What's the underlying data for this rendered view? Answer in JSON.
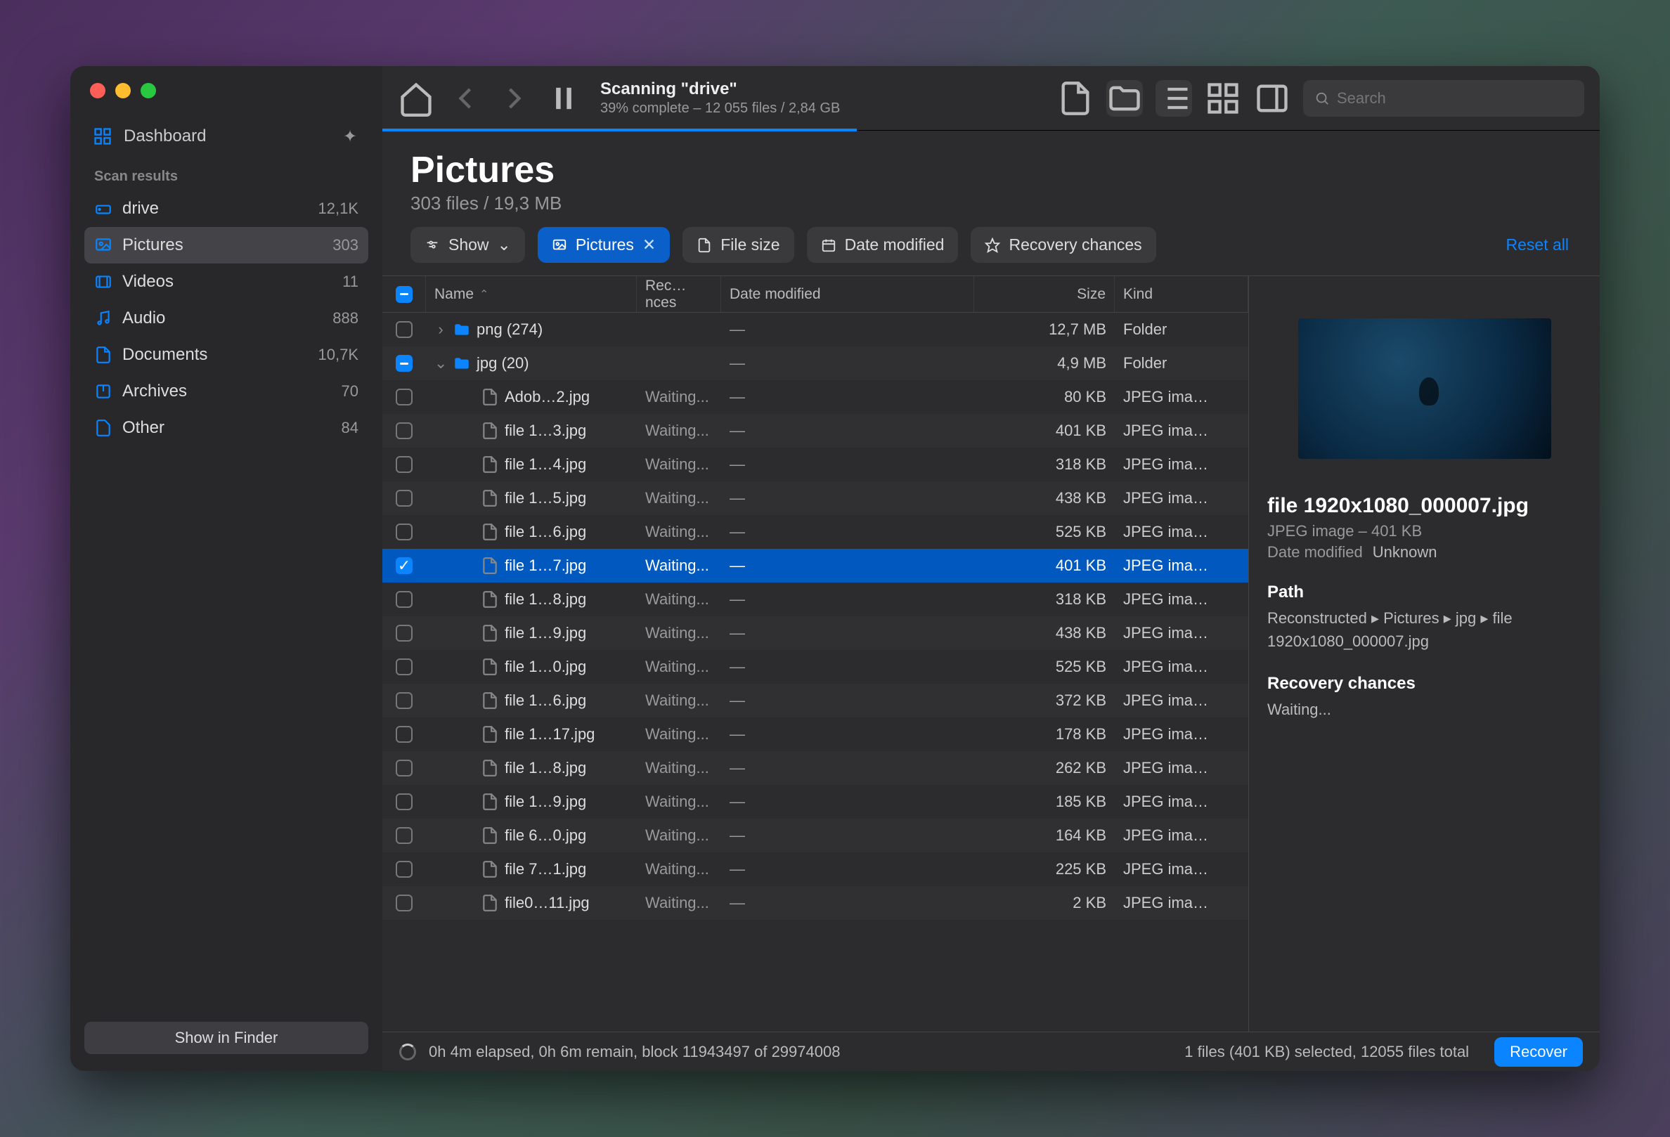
{
  "sidebar": {
    "dashboard": "Dashboard",
    "section_label": "Scan results",
    "items": [
      {
        "icon": "drive-icon",
        "label": "drive",
        "count": "12,1K"
      },
      {
        "icon": "image-icon",
        "label": "Pictures",
        "count": "303",
        "active": true
      },
      {
        "icon": "video-icon",
        "label": "Videos",
        "count": "11"
      },
      {
        "icon": "audio-icon",
        "label": "Audio",
        "count": "888"
      },
      {
        "icon": "doc-icon",
        "label": "Documents",
        "count": "10,7K"
      },
      {
        "icon": "archive-icon",
        "label": "Archives",
        "count": "70"
      },
      {
        "icon": "other-icon",
        "label": "Other",
        "count": "84"
      }
    ],
    "show_in_finder": "Show in Finder"
  },
  "toolbar": {
    "scan_title": "Scanning \"drive\"",
    "scan_sub": "39% complete – 12 055 files / 2,84 GB",
    "search_placeholder": "Search"
  },
  "header": {
    "title": "Pictures",
    "sub": "303 files / 19,3 MB"
  },
  "filters": {
    "show": "Show",
    "pictures": "Pictures",
    "file_size": "File size",
    "date_modified": "Date modified",
    "recovery_chances": "Recovery chances",
    "reset_all": "Reset all"
  },
  "columns": {
    "name": "Name",
    "rec": "Rec…nces",
    "date": "Date modified",
    "size": "Size",
    "kind": "Kind"
  },
  "rows": [
    {
      "type": "folder",
      "disclosure": "right",
      "name": "png (274)",
      "rec": "",
      "date": "—",
      "size": "12,7 MB",
      "kind": "Folder",
      "cb": "empty"
    },
    {
      "type": "folder",
      "disclosure": "down",
      "name": "jpg (20)",
      "rec": "",
      "date": "—",
      "size": "4,9 MB",
      "kind": "Folder",
      "cb": "dash"
    },
    {
      "type": "file",
      "name": "Adob…2.jpg",
      "rec": "Waiting...",
      "date": "—",
      "size": "80 KB",
      "kind": "JPEG ima…",
      "cb": "empty"
    },
    {
      "type": "file",
      "name": "file 1…3.jpg",
      "rec": "Waiting...",
      "date": "—",
      "size": "401 KB",
      "kind": "JPEG ima…",
      "cb": "empty"
    },
    {
      "type": "file",
      "name": "file 1…4.jpg",
      "rec": "Waiting...",
      "date": "—",
      "size": "318 KB",
      "kind": "JPEG ima…",
      "cb": "empty"
    },
    {
      "type": "file",
      "name": "file 1…5.jpg",
      "rec": "Waiting...",
      "date": "—",
      "size": "438 KB",
      "kind": "JPEG ima…",
      "cb": "empty"
    },
    {
      "type": "file",
      "name": "file 1…6.jpg",
      "rec": "Waiting...",
      "date": "—",
      "size": "525 KB",
      "kind": "JPEG ima…",
      "cb": "empty"
    },
    {
      "type": "file",
      "name": "file 1…7.jpg",
      "rec": "Waiting...",
      "date": "—",
      "size": "401 KB",
      "kind": "JPEG ima…",
      "cb": "checked",
      "selected": true
    },
    {
      "type": "file",
      "name": "file 1…8.jpg",
      "rec": "Waiting...",
      "date": "—",
      "size": "318 KB",
      "kind": "JPEG ima…",
      "cb": "empty"
    },
    {
      "type": "file",
      "name": "file 1…9.jpg",
      "rec": "Waiting...",
      "date": "—",
      "size": "438 KB",
      "kind": "JPEG ima…",
      "cb": "empty"
    },
    {
      "type": "file",
      "name": "file 1…0.jpg",
      "rec": "Waiting...",
      "date": "—",
      "size": "525 KB",
      "kind": "JPEG ima…",
      "cb": "empty"
    },
    {
      "type": "file",
      "name": "file 1…6.jpg",
      "rec": "Waiting...",
      "date": "—",
      "size": "372 KB",
      "kind": "JPEG ima…",
      "cb": "empty"
    },
    {
      "type": "file",
      "name": "file 1…17.jpg",
      "rec": "Waiting...",
      "date": "—",
      "size": "178 KB",
      "kind": "JPEG ima…",
      "cb": "empty"
    },
    {
      "type": "file",
      "name": "file 1…8.jpg",
      "rec": "Waiting...",
      "date": "—",
      "size": "262 KB",
      "kind": "JPEG ima…",
      "cb": "empty"
    },
    {
      "type": "file",
      "name": "file 1…9.jpg",
      "rec": "Waiting...",
      "date": "—",
      "size": "185 KB",
      "kind": "JPEG ima…",
      "cb": "empty"
    },
    {
      "type": "file",
      "name": "file 6…0.jpg",
      "rec": "Waiting...",
      "date": "—",
      "size": "164 KB",
      "kind": "JPEG ima…",
      "cb": "empty"
    },
    {
      "type": "file",
      "name": "file 7…1.jpg",
      "rec": "Waiting...",
      "date": "—",
      "size": "225 KB",
      "kind": "JPEG ima…",
      "cb": "empty"
    },
    {
      "type": "file",
      "name": "file0…11.jpg",
      "rec": "Waiting...",
      "date": "—",
      "size": "2 KB",
      "kind": "JPEG ima…",
      "cb": "empty"
    }
  ],
  "detail": {
    "title": "file 1920x1080_000007.jpg",
    "sub": "JPEG image – 401 KB",
    "date_label": "Date modified",
    "date_value": "Unknown",
    "path_label": "Path",
    "path_value": "Reconstructed ▸ Pictures ▸ jpg ▸ file 1920x1080_000007.jpg",
    "chances_label": "Recovery chances",
    "chances_value": "Waiting..."
  },
  "status": {
    "elapsed": "0h 4m elapsed, 0h 6m remain, block 11943497 of 29974008",
    "selection": "1 files (401 KB) selected, 12055 files total",
    "recover": "Recover"
  }
}
